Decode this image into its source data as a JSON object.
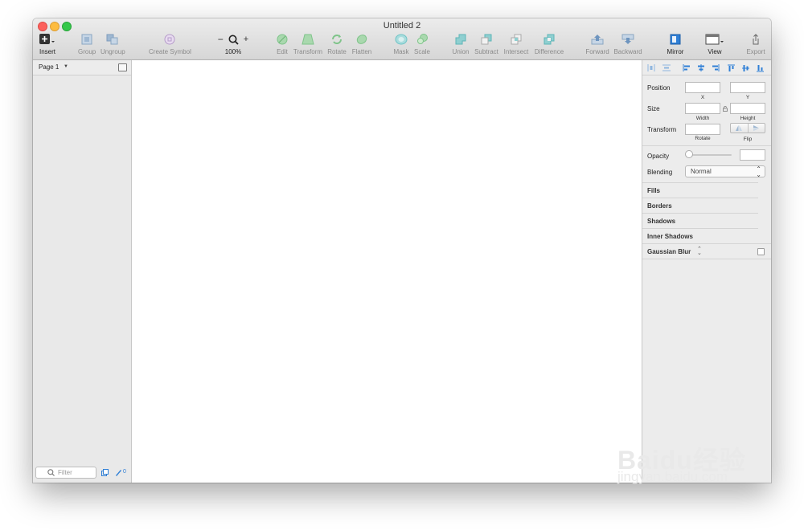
{
  "window": {
    "title": "Untitled 2"
  },
  "toolbar": {
    "insert": "Insert",
    "group": "Group",
    "ungroup": "Ungroup",
    "create_symbol": "Create Symbol",
    "zoom_minus": "−",
    "zoom_plus": "+",
    "zoom_level": "100%",
    "edit": "Edit",
    "transform": "Transform",
    "rotate": "Rotate",
    "flatten": "Flatten",
    "mask": "Mask",
    "scale": "Scale",
    "union": "Union",
    "subtract": "Subtract",
    "intersect": "Intersect",
    "difference": "Difference",
    "forward": "Forward",
    "backward": "Backward",
    "mirror": "Mirror",
    "view": "View",
    "export": "Export"
  },
  "sidebar": {
    "page_label": "Page 1",
    "filter_placeholder": "Filter",
    "slice_count": "0"
  },
  "inspector": {
    "position_label": "Position",
    "x_label": "X",
    "y_label": "Y",
    "size_label": "Size",
    "width_label": "Width",
    "height_label": "Height",
    "transform_label": "Transform",
    "rotate_label": "Rotate",
    "flip_label": "Flip",
    "opacity_label": "Opacity",
    "blending_label": "Blending",
    "blending_value": "Normal",
    "sections": [
      "Fills",
      "Borders",
      "Shadows",
      "Inner Shadows",
      "Gaussian Blur"
    ]
  },
  "watermark": {
    "logo": "Baidu经验",
    "url": "jingyan.baidu.com"
  },
  "colors": {
    "close": "#fc605c",
    "minimize": "#fdbc40",
    "zoom": "#34c84a",
    "tool_green": "#7fc48a",
    "tool_teal": "#6ec4c6",
    "accent_blue": "#2f7fd6"
  }
}
